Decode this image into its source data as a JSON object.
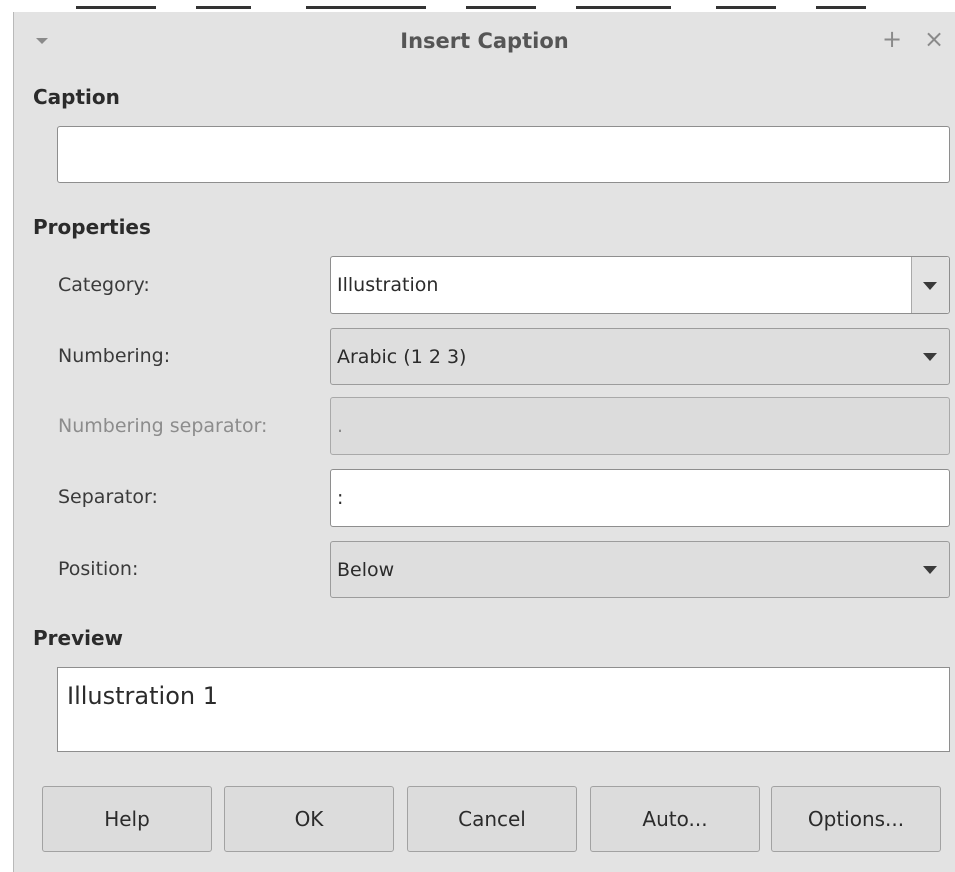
{
  "window": {
    "title": "Insert Caption",
    "menu_icon": "triangle-down-icon",
    "maximize_glyph": "+",
    "close_glyph": "×"
  },
  "caption": {
    "section_label": "Caption",
    "value": ""
  },
  "properties": {
    "section_label": "Properties",
    "category": {
      "label": "Category:",
      "value": "Illustration"
    },
    "numbering": {
      "label": "Numbering:",
      "value": "Arabic (1 2 3)"
    },
    "numbering_separator": {
      "label": "Numbering separator:",
      "value": "."
    },
    "separator": {
      "label": "Separator:",
      "value": ":"
    },
    "position": {
      "label": "Position:",
      "value": "Below"
    }
  },
  "preview": {
    "section_label": "Preview",
    "text": "Illustration 1"
  },
  "buttons": {
    "help": "Help",
    "ok": "OK",
    "cancel": "Cancel",
    "auto": "Auto...",
    "options": "Options..."
  }
}
